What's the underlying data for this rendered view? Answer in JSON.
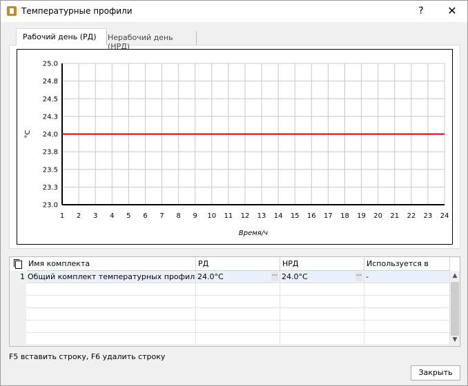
{
  "window": {
    "title": "Температурные профили",
    "help_label": "?",
    "close_label": "✕"
  },
  "tabs": [
    {
      "label": "Рабочий день (РД)",
      "active": true
    },
    {
      "label": "Нерабочий день (НРД)",
      "active": false
    }
  ],
  "chart_data": {
    "type": "line",
    "xlabel": "Время/ч",
    "ylabel": "°С",
    "xlim": [
      1,
      24
    ],
    "ylim": [
      23.0,
      25.0
    ],
    "x_ticks": [
      1,
      2,
      3,
      4,
      5,
      6,
      7,
      8,
      9,
      10,
      11,
      12,
      13,
      14,
      15,
      16,
      17,
      18,
      19,
      20,
      21,
      22,
      23,
      24
    ],
    "y_ticks": [
      "25.0",
      "24.8",
      "24.5",
      "24.3",
      "24.0",
      "23.8",
      "23.5",
      "23.3",
      "23.0"
    ],
    "grid": true,
    "series": [
      {
        "x": [
          1,
          2,
          3,
          4,
          5,
          6,
          7,
          8,
          9,
          10,
          11,
          12,
          13,
          14,
          15,
          16,
          17,
          18,
          19,
          20,
          21,
          22,
          23,
          24
        ],
        "y": [
          24.0,
          24.0,
          24.0,
          24.0,
          24.0,
          24.0,
          24.0,
          24.0,
          24.0,
          24.0,
          24.0,
          24.0,
          24.0,
          24.0,
          24.0,
          24.0,
          24.0,
          24.0,
          24.0,
          24.0,
          24.0,
          24.0,
          24.0,
          24.0
        ],
        "color": "#e00000"
      }
    ]
  },
  "table": {
    "columns": [
      "Имя комплекта",
      "РД",
      "НРД",
      "Используется в"
    ],
    "rows": [
      {
        "num": "1",
        "name": "Общий комплект температурных профилей",
        "rd": "24.0°C",
        "nrd": "24.0°C",
        "used": "-"
      }
    ]
  },
  "hint": "F5 вставить строку, F6 удалить строку",
  "close_button": "Закрыть",
  "colors": {
    "line": "#e00000",
    "selected_row": "#eaf1fb"
  }
}
